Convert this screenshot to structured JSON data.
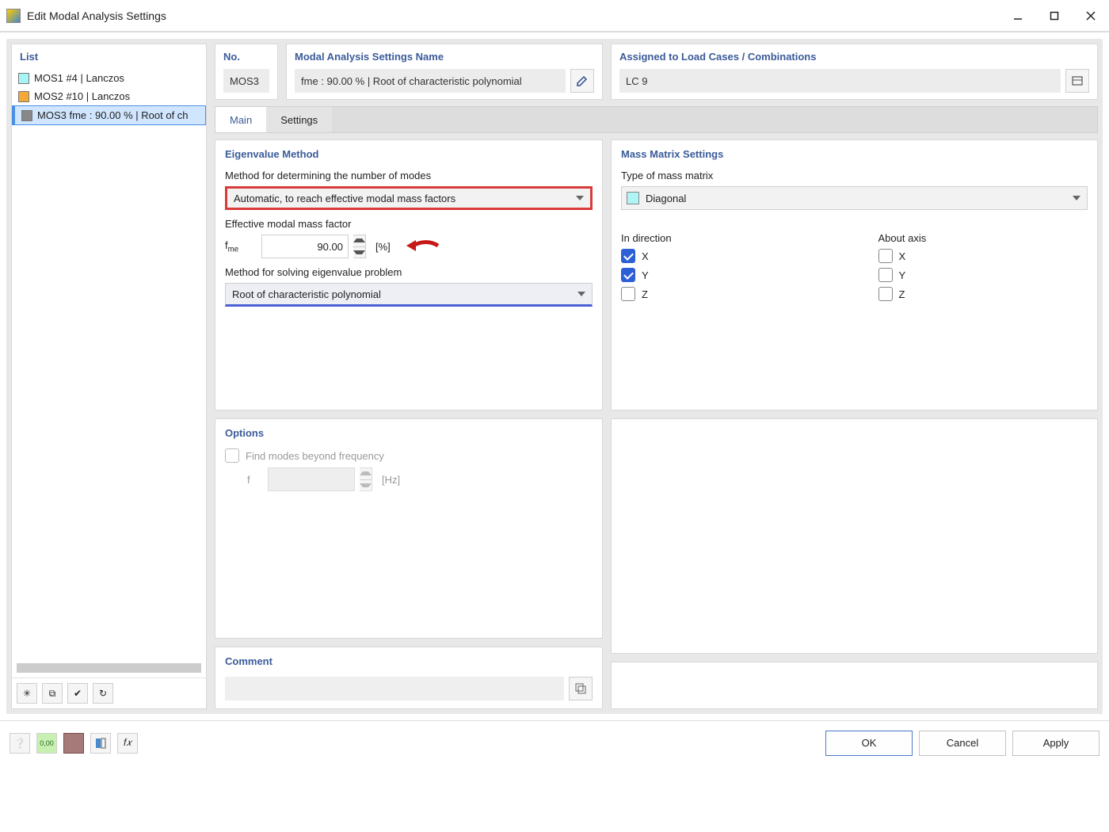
{
  "window": {
    "title": "Edit Modal Analysis Settings"
  },
  "sidebar": {
    "title": "List",
    "items": [
      {
        "id": "MOS1",
        "label": "MOS1  #4 | Lanczos",
        "color": "swatch-cyan"
      },
      {
        "id": "MOS2",
        "label": "MOS2  #10 | Lanczos",
        "color": "swatch-orange"
      },
      {
        "id": "MOS3",
        "label": "MOS3  fme : 90.00 % | Root of ch",
        "color": "swatch-gray",
        "selected": true
      }
    ]
  },
  "header": {
    "no_label": "No.",
    "no_value": "MOS3",
    "name_label": "Modal Analysis Settings Name",
    "name_value": "fme : 90.00 % | Root of characteristic polynomial",
    "assigned_label": "Assigned to Load Cases / Combinations",
    "assigned_value": "LC 9"
  },
  "tabs": {
    "main": "Main",
    "settings": "Settings"
  },
  "eigen": {
    "title": "Eigenvalue Method",
    "method_modes_label": "Method for determining the number of modes",
    "method_modes_value": "Automatic, to reach effective modal mass factors",
    "emmf_label": "Effective modal mass factor",
    "emmf_prefix": "fme",
    "emmf_value": "90.00",
    "emmf_unit": "[%]",
    "solver_label": "Method for solving eigenvalue problem",
    "solver_value": "Root of characteristic polynomial"
  },
  "mass": {
    "title": "Mass Matrix Settings",
    "type_label": "Type of mass matrix",
    "type_value": "Diagonal",
    "direction_label": "In direction",
    "axis_label": "About axis",
    "x": "X",
    "y": "Y",
    "z": "Z"
  },
  "options": {
    "title": "Options",
    "find_modes_label": "Find modes beyond frequency",
    "f_label": "f",
    "f_unit": "[Hz]"
  },
  "comment": {
    "title": "Comment",
    "value": ""
  },
  "buttons": {
    "ok": "OK",
    "cancel": "Cancel",
    "apply": "Apply"
  }
}
